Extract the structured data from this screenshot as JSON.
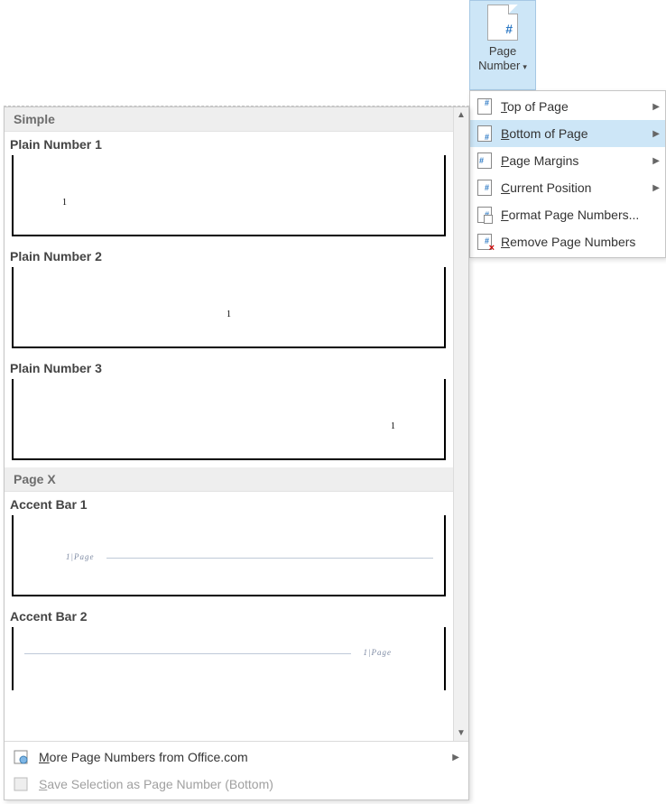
{
  "ribbon": {
    "button_label_line1": "Page",
    "button_label_line2": "Number"
  },
  "menu": {
    "items": [
      {
        "label": "Top of Page",
        "key": "T",
        "icon": "page-top-icon",
        "submenu": true,
        "highlight": false
      },
      {
        "label": "Bottom of Page",
        "key": "B",
        "icon": "page-bottom-icon",
        "submenu": true,
        "highlight": true
      },
      {
        "label": "Page Margins",
        "key": "P",
        "icon": "page-margins-icon",
        "submenu": true,
        "highlight": false
      },
      {
        "label": "Current Position",
        "key": "C",
        "icon": "page-current-icon",
        "submenu": true,
        "highlight": false
      },
      {
        "label": "Format Page Numbers...",
        "key": "F",
        "icon": "format-page-numbers-icon",
        "submenu": false,
        "highlight": false
      },
      {
        "label": "Remove Page Numbers",
        "key": "R",
        "icon": "remove-page-numbers-icon",
        "submenu": false,
        "highlight": false
      }
    ]
  },
  "gallery": {
    "categories": [
      {
        "name": "Simple",
        "items": [
          {
            "title": "Plain Number 1",
            "preview_kind": "p1",
            "sample": "1"
          },
          {
            "title": "Plain Number 2",
            "preview_kind": "p2",
            "sample": "1"
          },
          {
            "title": "Plain Number 3",
            "preview_kind": "p3",
            "sample": "1"
          }
        ]
      },
      {
        "name": "Page X",
        "items": [
          {
            "title": "Accent Bar 1",
            "preview_kind": "a1",
            "sample": "1|Page"
          },
          {
            "title": "Accent Bar 2",
            "preview_kind": "a2",
            "sample": "1|Page"
          }
        ]
      }
    ],
    "footer": {
      "more_label": "More Page Numbers from Office.com",
      "more_key": "M",
      "save_label": "Save Selection as Page Number (Bottom)",
      "save_key": "S",
      "save_enabled": false
    }
  }
}
